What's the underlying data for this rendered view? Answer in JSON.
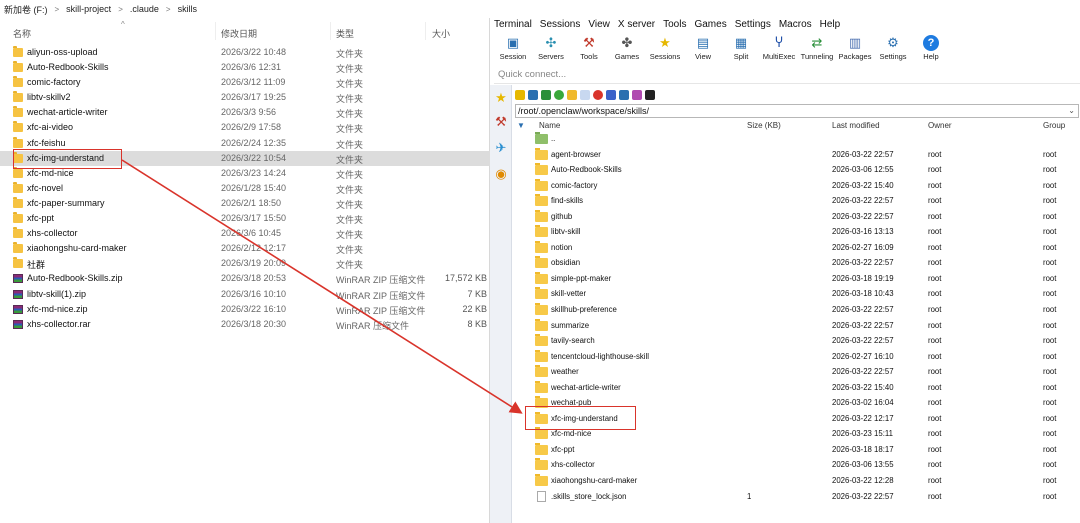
{
  "explorer": {
    "breadcrumb": [
      "新加卷 (F:)",
      "skill-project",
      ".claude",
      "skills"
    ],
    "columns": {
      "name": "名称",
      "date": "修改日期",
      "type": "类型",
      "size": "大小"
    },
    "rows": [
      {
        "name": "aliyun-oss-upload",
        "date": "2026/3/22 10:48",
        "type": "文件夹",
        "size": "",
        "kind": "folder"
      },
      {
        "name": "Auto-Redbook-Skills",
        "date": "2026/3/6 12:31",
        "type": "文件夹",
        "size": "",
        "kind": "folder"
      },
      {
        "name": "comic-factory",
        "date": "2026/3/12 11:09",
        "type": "文件夹",
        "size": "",
        "kind": "folder"
      },
      {
        "name": "libtv-skillv2",
        "date": "2026/3/17 19:25",
        "type": "文件夹",
        "size": "",
        "kind": "folder"
      },
      {
        "name": "wechat-article-writer",
        "date": "2026/3/3 9:56",
        "type": "文件夹",
        "size": "",
        "kind": "folder"
      },
      {
        "name": "xfc-ai-video",
        "date": "2026/2/9 17:58",
        "type": "文件夹",
        "size": "",
        "kind": "folder"
      },
      {
        "name": "xfc-feishu",
        "date": "2026/2/24 12:35",
        "type": "文件夹",
        "size": "",
        "kind": "folder"
      },
      {
        "name": "xfc-img-understand",
        "date": "2026/3/22 10:54",
        "type": "文件夹",
        "size": "",
        "kind": "folder",
        "selected": true
      },
      {
        "name": "xfc-md-nice",
        "date": "2026/3/23 14:24",
        "type": "文件夹",
        "size": "",
        "kind": "folder"
      },
      {
        "name": "xfc-novel",
        "date": "2026/1/28 15:40",
        "type": "文件夹",
        "size": "",
        "kind": "folder"
      },
      {
        "name": "xfc-paper-summary",
        "date": "2026/2/1 18:50",
        "type": "文件夹",
        "size": "",
        "kind": "folder"
      },
      {
        "name": "xfc-ppt",
        "date": "2026/3/17 15:50",
        "type": "文件夹",
        "size": "",
        "kind": "folder"
      },
      {
        "name": "xhs-collector",
        "date": "2026/3/6 10:45",
        "type": "文件夹",
        "size": "",
        "kind": "folder"
      },
      {
        "name": "xiaohongshu-card-maker",
        "date": "2026/2/12 12:17",
        "type": "文件夹",
        "size": "",
        "kind": "folder"
      },
      {
        "name": "社群",
        "date": "2026/3/19 20:09",
        "type": "文件夹",
        "size": "",
        "kind": "folder"
      },
      {
        "name": "Auto-Redbook-Skills.zip",
        "date": "2026/3/18 20:53",
        "type": "WinRAR ZIP 压缩文件",
        "size": "17,572 KB",
        "kind": "rar"
      },
      {
        "name": "libtv-skill(1).zip",
        "date": "2026/3/16 10:10",
        "type": "WinRAR ZIP 压缩文件",
        "size": "7 KB",
        "kind": "rar"
      },
      {
        "name": "xfc-md-nice.zip",
        "date": "2026/3/22 16:10",
        "type": "WinRAR ZIP 压缩文件",
        "size": "22 KB",
        "kind": "rar"
      },
      {
        "name": "xhs-collector.rar",
        "date": "2026/3/18 20:30",
        "type": "WinRAR 压缩文件",
        "size": "8 KB",
        "kind": "rar"
      }
    ]
  },
  "moba": {
    "menu": [
      "Terminal",
      "Sessions",
      "View",
      "X server",
      "Tools",
      "Games",
      "Settings",
      "Macros",
      "Help"
    ],
    "toolbar": [
      {
        "label": "Session",
        "icon": "monitor-icon",
        "color": "#2a6fb0"
      },
      {
        "label": "Servers",
        "icon": "servers-icon",
        "color": "#2a8fb0"
      },
      {
        "label": "Tools",
        "icon": "tools-icon",
        "color": "#c0392b"
      },
      {
        "label": "Games",
        "icon": "gamepad-icon",
        "color": "#555555"
      },
      {
        "label": "Sessions",
        "icon": "star-icon",
        "color": "#e6b800"
      },
      {
        "label": "View",
        "icon": "view-icon",
        "color": "#2a6fb0"
      },
      {
        "label": "Split",
        "icon": "split-icon",
        "color": "#2a6fb0"
      },
      {
        "label": "MultiExec",
        "icon": "fork-icon",
        "color": "#1f4fa8"
      },
      {
        "label": "Tunneling",
        "icon": "tunnel-icon",
        "color": "#2a8f3a"
      },
      {
        "label": "Packages",
        "icon": "packages-icon",
        "color": "#4a6fb0"
      },
      {
        "label": "Settings",
        "icon": "gears-icon",
        "color": "#2a6fb0"
      },
      {
        "label": "Help",
        "icon": "help-icon",
        "color": "#1e7be0"
      }
    ],
    "quick_connect": "Quick connect...",
    "path": "/root/.openclaw/workspace/skills/",
    "columns": {
      "name": "Name",
      "size": "Size (KB)",
      "modified": "Last modified",
      "owner": "Owner",
      "group": "Group"
    },
    "rows": [
      {
        "name": "..",
        "size": "",
        "modified": "",
        "owner": "",
        "group": "",
        "kind": "up"
      },
      {
        "name": "agent-browser",
        "size": "",
        "modified": "2026-03-22 22:57",
        "owner": "root",
        "group": "root",
        "kind": "folder"
      },
      {
        "name": "Auto-Redbook-Skills",
        "size": "",
        "modified": "2026-03-06 12:55",
        "owner": "root",
        "group": "root",
        "kind": "folder"
      },
      {
        "name": "comic-factory",
        "size": "",
        "modified": "2026-03-22 15:40",
        "owner": "root",
        "group": "root",
        "kind": "folder"
      },
      {
        "name": "find-skills",
        "size": "",
        "modified": "2026-03-22 22:57",
        "owner": "root",
        "group": "root",
        "kind": "folder"
      },
      {
        "name": "github",
        "size": "",
        "modified": "2026-03-22 22:57",
        "owner": "root",
        "group": "root",
        "kind": "folder"
      },
      {
        "name": "libtv-skill",
        "size": "",
        "modified": "2026-03-16 13:13",
        "owner": "root",
        "group": "root",
        "kind": "folder"
      },
      {
        "name": "notion",
        "size": "",
        "modified": "2026-02-27 16:09",
        "owner": "root",
        "group": "root",
        "kind": "folder"
      },
      {
        "name": "obsidian",
        "size": "",
        "modified": "2026-03-22 22:57",
        "owner": "root",
        "group": "root",
        "kind": "folder"
      },
      {
        "name": "simple-ppt-maker",
        "size": "",
        "modified": "2026-03-18 19:19",
        "owner": "root",
        "group": "root",
        "kind": "folder"
      },
      {
        "name": "skill-vetter",
        "size": "",
        "modified": "2026-03-18 10:43",
        "owner": "root",
        "group": "root",
        "kind": "folder"
      },
      {
        "name": "skillhub-preference",
        "size": "",
        "modified": "2026-03-22 22:57",
        "owner": "root",
        "group": "root",
        "kind": "folder"
      },
      {
        "name": "summarize",
        "size": "",
        "modified": "2026-03-22 22:57",
        "owner": "root",
        "group": "root",
        "kind": "folder"
      },
      {
        "name": "tavily-search",
        "size": "",
        "modified": "2026-03-22 22:57",
        "owner": "root",
        "group": "root",
        "kind": "folder"
      },
      {
        "name": "tencentcloud-lighthouse-skill",
        "size": "",
        "modified": "2026-02-27 16:10",
        "owner": "root",
        "group": "root",
        "kind": "folder"
      },
      {
        "name": "weather",
        "size": "",
        "modified": "2026-03-22 22:57",
        "owner": "root",
        "group": "root",
        "kind": "folder"
      },
      {
        "name": "wechat-article-writer",
        "size": "",
        "modified": "2026-03-22 15:40",
        "owner": "root",
        "group": "root",
        "kind": "folder"
      },
      {
        "name": "wechat-pub",
        "size": "",
        "modified": "2026-03-02 16:04",
        "owner": "root",
        "group": "root",
        "kind": "folder"
      },
      {
        "name": "xfc-img-understand",
        "size": "",
        "modified": "2026-03-22 12:17",
        "owner": "root",
        "group": "root",
        "kind": "folder"
      },
      {
        "name": "xfc-md-nice",
        "size": "",
        "modified": "2026-03-23 15:11",
        "owner": "root",
        "group": "root",
        "kind": "folder"
      },
      {
        "name": "xfc-ppt",
        "size": "",
        "modified": "2026-03-18 18:17",
        "owner": "root",
        "group": "root",
        "kind": "folder"
      },
      {
        "name": "xhs-collector",
        "size": "",
        "modified": "2026-03-06 13:55",
        "owner": "root",
        "group": "root",
        "kind": "folder"
      },
      {
        "name": "xiaohongshu-card-maker",
        "size": "",
        "modified": "2026-03-22 12:28",
        "owner": "root",
        "group": "root",
        "kind": "folder"
      },
      {
        "name": ".skills_store_lock.json",
        "size": "1",
        "modified": "2026-03-22 22:57",
        "owner": "root",
        "group": "root",
        "kind": "file"
      }
    ]
  },
  "colors": {
    "highlight": "#d9342b",
    "selection": "#dcdcdc",
    "folder": "#f6c342"
  }
}
